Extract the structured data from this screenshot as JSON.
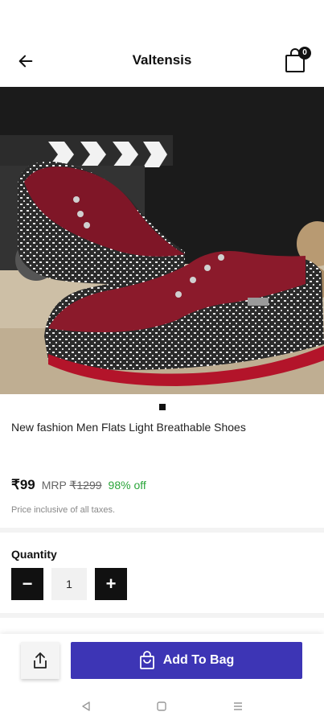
{
  "header": {
    "title": "Valtensis",
    "bag_count": "0"
  },
  "product": {
    "name": "New fashion Men Flats Light Breathable Shoes",
    "price": "₹99",
    "mrp_label": "MRP",
    "mrp_value": "₹1299",
    "discount": "98% off",
    "tax_note": "Price inclusive of all taxes."
  },
  "quantity": {
    "label": "Quantity",
    "value": "1",
    "minus": "−",
    "plus": "+"
  },
  "actions": {
    "add_to_bag": "Add To Bag"
  },
  "colors": {
    "accent": "#3d35b5",
    "discount": "#2aa53a",
    "shoe": "#8b1a2b"
  }
}
